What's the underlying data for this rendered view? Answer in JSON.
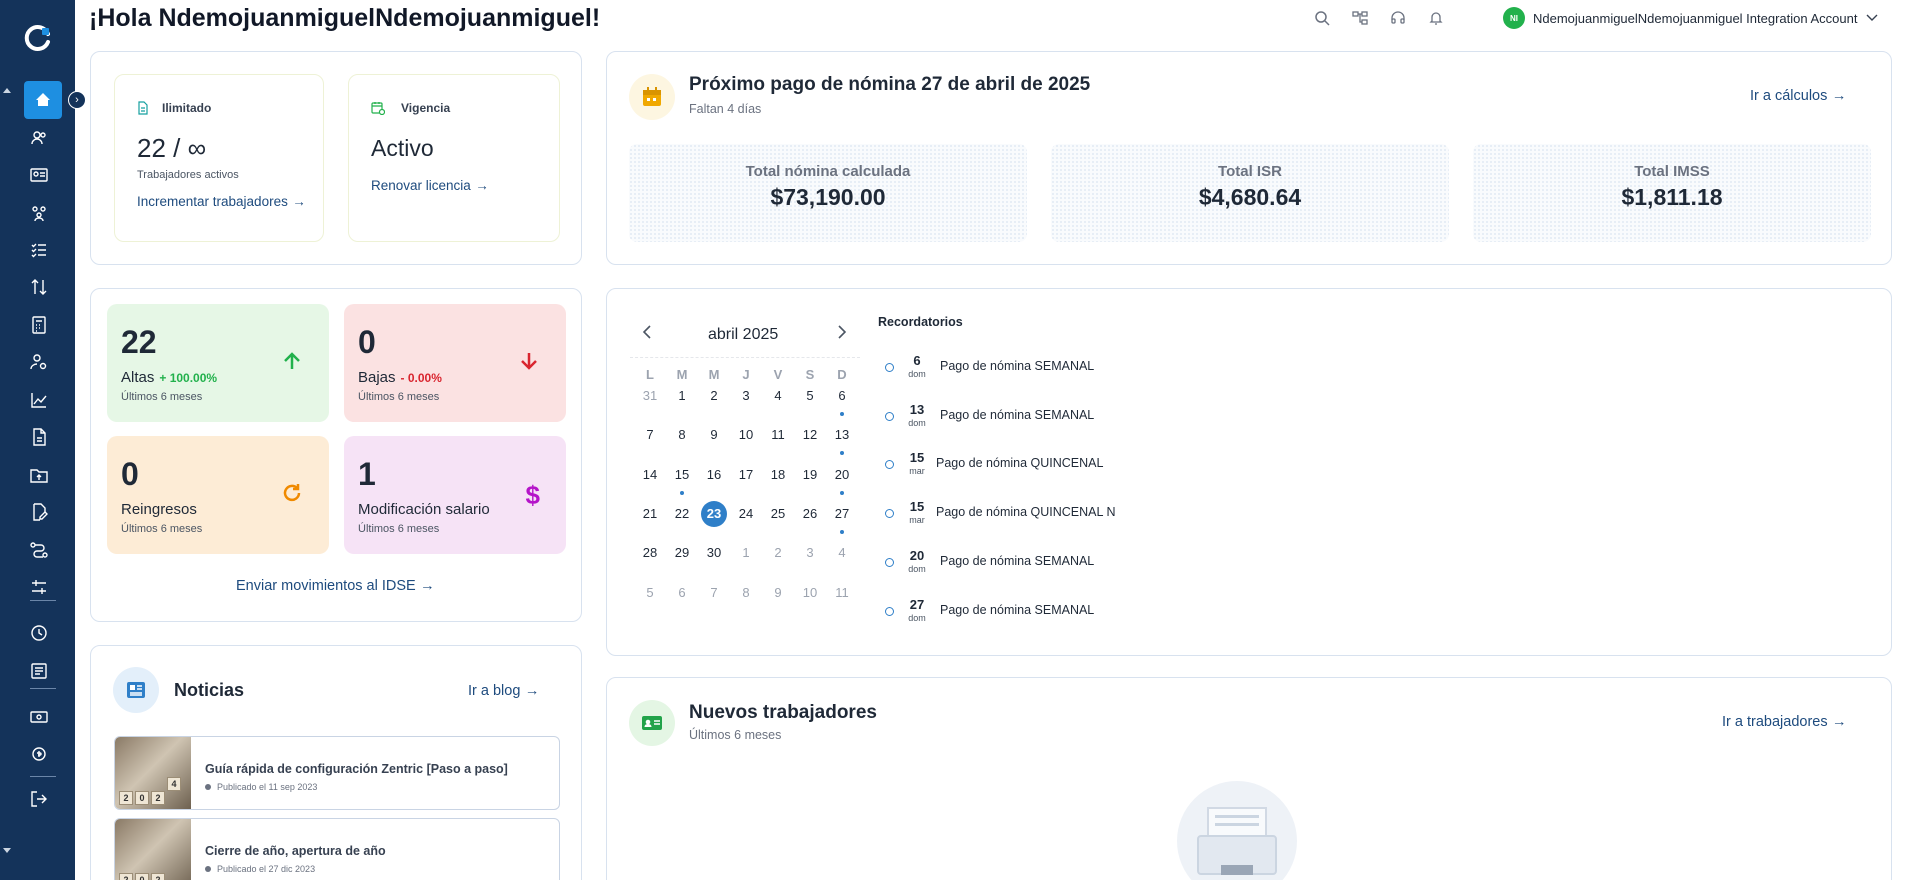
{
  "header": {
    "greeting": "¡Hola NdemojuanmiguelNdemojuanmiguel!",
    "account_name": "NdemojuanmiguelNdemojuanmiguel Integration Account",
    "avatar_initials": "NI",
    "icons": [
      "search-icon",
      "org-chart-icon",
      "support-headset-icon",
      "bell-icon"
    ]
  },
  "sidebar": {
    "icons": [
      "home-icon",
      "users-icon",
      "id-card-icon",
      "team-icon",
      "checklist-icon",
      "transfer-icon",
      "calculator-icon",
      "user-settings-icon",
      "chart-icon",
      "document-icon",
      "folder-upload-icon",
      "document-edit-icon",
      "flow-icon",
      "sliders-icon",
      "clock-icon",
      "report-icon",
      "money-icon",
      "payroll-settings-icon",
      "logout-icon"
    ]
  },
  "license": {
    "plan_label": "Ilimitado",
    "workers_count": "22 / ∞",
    "workers_caption": "Trabajadores activos",
    "increase_link": "Incrementar trabajadores",
    "validity_label": "Vigencia",
    "validity_value": "Activo",
    "renew_link": "Renovar licencia"
  },
  "payroll": {
    "title": "Próximo pago de nómina 27 de abril de 2025",
    "subtitle": "Faltan 4 días",
    "link": "Ir a cálculos",
    "totals": [
      {
        "label": "Total nómina calculada",
        "value": "$73,190.00"
      },
      {
        "label": "Total ISR",
        "value": "$4,680.64"
      },
      {
        "label": "Total IMSS",
        "value": "$1,811.18"
      }
    ]
  },
  "movements": {
    "tiles": [
      {
        "value": "22",
        "label": "Altas",
        "pct": "+ 100.00%",
        "sub": "Últimos 6 meses"
      },
      {
        "value": "0",
        "label": "Bajas",
        "pct": "- 0.00%",
        "sub": "Últimos 6 meses"
      },
      {
        "value": "0",
        "label": "Reingresos",
        "pct": "",
        "sub": "Últimos 6 meses"
      },
      {
        "value": "1",
        "label": "Modificación salario",
        "pct": "",
        "sub": "Últimos 6 meses"
      }
    ],
    "idse_link": "Enviar movimientos al IDSE"
  },
  "calendar": {
    "month": "abril 2025",
    "weekdays": [
      "L",
      "M",
      "M",
      "J",
      "V",
      "S",
      "D"
    ],
    "weeks": [
      [
        "31",
        "1",
        "2",
        "3",
        "4",
        "5",
        "6"
      ],
      [
        "7",
        "8",
        "9",
        "10",
        "11",
        "12",
        "13"
      ],
      [
        "14",
        "15",
        "16",
        "17",
        "18",
        "19",
        "20"
      ],
      [
        "21",
        "22",
        "23",
        "24",
        "25",
        "26",
        "27"
      ],
      [
        "28",
        "29",
        "30",
        "1",
        "2",
        "3",
        "4"
      ],
      [
        "5",
        "6",
        "7",
        "8",
        "9",
        "10",
        "11"
      ]
    ],
    "today": "23"
  },
  "reminders": {
    "title": "Recordatorios",
    "items": [
      {
        "day": "6",
        "dow": "dom",
        "text": "Pago de nómina SEMANAL"
      },
      {
        "day": "13",
        "dow": "dom",
        "text": "Pago de nómina SEMANAL"
      },
      {
        "day": "15",
        "dow": "mar",
        "text": "Pago de nómina QUINCENAL"
      },
      {
        "day": "15",
        "dow": "mar",
        "text": "Pago de nómina QUINCENAL N"
      },
      {
        "day": "20",
        "dow": "dom",
        "text": "Pago de nómina SEMANAL"
      },
      {
        "day": "27",
        "dow": "dom",
        "text": "Pago de nómina SEMANAL"
      }
    ]
  },
  "news": {
    "title": "Noticias",
    "link": "Ir a blog",
    "items": [
      {
        "title": "Guía rápida de configuración Zentric [Paso a paso]",
        "date": "Publicado el 11 sep 2023"
      },
      {
        "title": "Cierre de año, apertura de año",
        "date": "Publicado el 27 dic 2023"
      }
    ]
  },
  "new_workers": {
    "title": "Nuevos trabajadores",
    "subtitle": "Últimos 6 meses",
    "link": "Ir a trabajadores"
  },
  "colors": {
    "sidebar": "#14335a",
    "accent": "#1e8fe1",
    "link": "#1e4b7e",
    "green": "#22b14c",
    "red": "#d9252f",
    "orange": "#f08a00",
    "purple": "#b514c9"
  }
}
